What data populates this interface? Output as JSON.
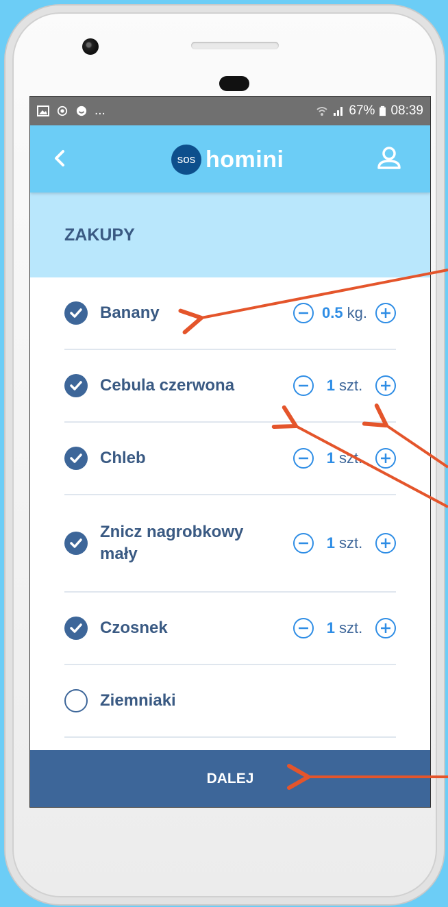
{
  "status_bar": {
    "left_icons": [
      "image-icon",
      "sync-icon",
      "face-icon"
    ],
    "left_more": "...",
    "battery": "67%",
    "time": "08:39"
  },
  "app_bar": {
    "logo_badge": "sos",
    "logo_text": "homini"
  },
  "section": {
    "title": "ZAKUPY"
  },
  "items": [
    {
      "name": "Banany",
      "checked": true,
      "amount": "0.5",
      "unit": "kg."
    },
    {
      "name": "Cebula czerwona",
      "checked": true,
      "amount": "1",
      "unit": "szt."
    },
    {
      "name": "Chleb",
      "checked": true,
      "amount": "1",
      "unit": "szt."
    },
    {
      "name": "Znicz nagrobkowy mały",
      "checked": true,
      "amount": "1",
      "unit": "szt."
    },
    {
      "name": "Czosnek",
      "checked": true,
      "amount": "1",
      "unit": "szt."
    },
    {
      "name": "Ziemniaki",
      "checked": false
    }
  ],
  "footer": {
    "button_label": "DALEJ"
  },
  "colors": {
    "background": "#6ccdf6",
    "app_bar": "#6ccdf6",
    "section_header": "#b9e7fc",
    "primary_dark": "#3d6699",
    "accent_blue": "#2e8de5",
    "annotation_arrow": "#e4552b"
  }
}
